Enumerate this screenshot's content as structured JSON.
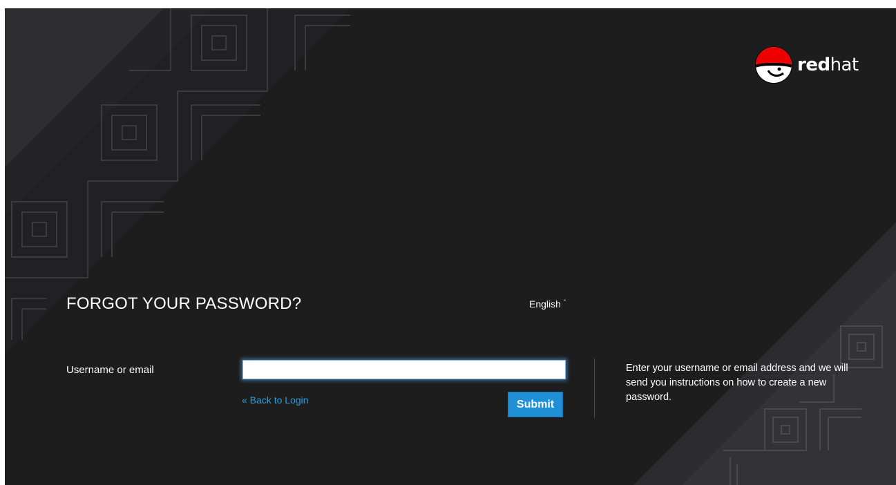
{
  "brand": {
    "wordmark_bold": "red",
    "wordmark_light": "hat",
    "hat_color": "#ee0000",
    "icon": "redhat-shadowman-logo"
  },
  "form": {
    "title": "FORGOT YOUR PASSWORD?",
    "language": "English",
    "language_icon": "chevron-down-icon",
    "username_label": "Username or email",
    "username_value": "",
    "back_link": "« Back to Login",
    "submit_label": "Submit",
    "info_text": "Enter your username or email address and we will send you instructions on how to create a new password."
  },
  "colors": {
    "background": "#1d1d1e",
    "accent": "#1f8fd6",
    "link": "#2a9fe0"
  }
}
